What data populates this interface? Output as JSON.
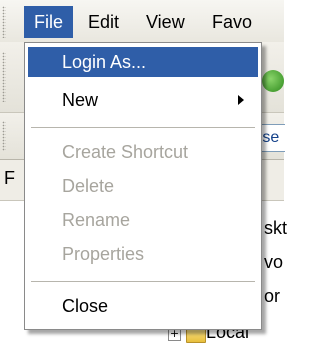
{
  "menubar": {
    "items": [
      "File",
      "Edit",
      "View",
      "Favo"
    ]
  },
  "address_partial": "rse",
  "pane_label": "F",
  "tree_partial": [
    "skt",
    "vo",
    "or",
    "Local"
  ],
  "file_menu": {
    "items": [
      {
        "label": "Login As...",
        "enabled": true,
        "selected": true
      },
      {
        "label": "New",
        "enabled": true,
        "submenu": true
      },
      {
        "label": "Create Shortcut",
        "enabled": false
      },
      {
        "label": "Delete",
        "enabled": false
      },
      {
        "label": "Rename",
        "enabled": false
      },
      {
        "label": "Properties",
        "enabled": false
      },
      {
        "label": "Close",
        "enabled": true
      }
    ]
  },
  "colors": {
    "highlight": "#2f5ea8",
    "disabled_text": "#a7a59e"
  }
}
